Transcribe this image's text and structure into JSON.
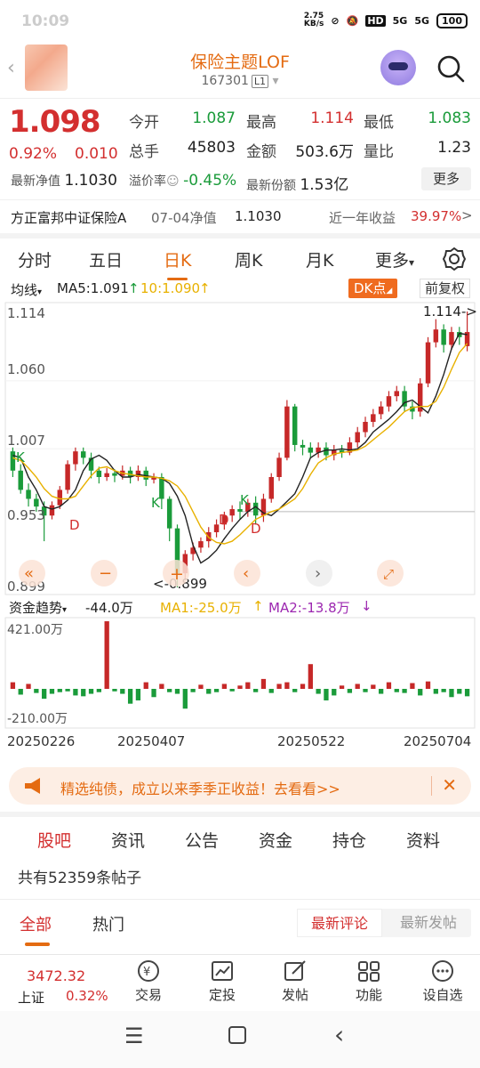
{
  "status": {
    "time": "10:09",
    "net_speed": "2.75\nKB/s",
    "battery": "100",
    "sig1": "5G",
    "sig2": "5G",
    "hd": "HD"
  },
  "header": {
    "back": "‹",
    "title": "保险主题LOF",
    "code": "167301",
    "tag": "L1"
  },
  "quote": {
    "price": "1.098",
    "change_pct": "0.92%",
    "change_abs": "0.010",
    "open_label": "今开",
    "open": "1.087",
    "high_label": "最高",
    "high": "1.114",
    "low_label": "最低",
    "low": "1.083",
    "vol_label": "总手",
    "vol": "45803",
    "amt_label": "金额",
    "amt": "503.6万",
    "ratio_label": "量比",
    "ratio": "1.23",
    "nav_label": "最新净值",
    "nav": "1.1030",
    "premium_label": "溢价率",
    "premium": "-0.45%",
    "shares_label": "最新份额",
    "shares": "1.53亿",
    "more": "更多"
  },
  "fund": {
    "name": "方正富邦中证保险A",
    "date": "07-04净值",
    "nav": "1.1030",
    "ret_label": "近一年收益",
    "ret": "39.97%",
    "arrow": ">"
  },
  "tabs": [
    "分时",
    "五日",
    "日K",
    "周K",
    "月K",
    "更多"
  ],
  "ma_row": {
    "ma_label": "均线",
    "ma5": "MA5:1.091",
    "ma10": "10:1.090",
    "dk": "DK点",
    "fq": "前复权"
  },
  "chart_labels": {
    "y1": "1.114",
    "y2": "1.060",
    "y3": "1.007",
    "y4": "0.953",
    "y5": "0.899",
    "low_mark": "<-0.899",
    "high_mark": "1.114->"
  },
  "flow": {
    "label": "资金趋势",
    "value": "-44.0万",
    "ma1": "MA1:-25.0万",
    "ma2": "MA2:-13.8万",
    "top": "421.00万",
    "bottom": "-210.00万",
    "dates": [
      "20250226",
      "20250407",
      "20250522",
      "20250704"
    ]
  },
  "banner": {
    "text": "精选纯债，成立以来季季正收益！去看看>>"
  },
  "sections": [
    "股吧",
    "资讯",
    "公告",
    "资金",
    "持仓",
    "资料"
  ],
  "post_count": "共有52359条帖子",
  "subtabs": [
    "全部",
    "热门"
  ],
  "sort": [
    "最新评论",
    "最新发帖"
  ],
  "botnav": {
    "index_value": "3472.32",
    "index_name": "上证",
    "index_pct": "0.32%",
    "items": [
      "交易",
      "定投",
      "发帖",
      "功能",
      "设自选"
    ]
  },
  "chart_data": {
    "type": "candlestick",
    "ylim": [
      0.899,
      1.114
    ],
    "y_ticks": [
      1.114,
      1.06,
      1.007,
      0.953,
      0.899
    ],
    "x_ticks": [
      "20250226",
      "20250407",
      "20250522",
      "20250704"
    ],
    "series": [
      {
        "name": "MA5",
        "values": [
          1.002,
          1.0,
          0.985,
          0.975,
          0.962,
          0.96,
          0.962,
          0.967,
          0.975,
          0.99,
          0.999,
          1.002,
          0.998,
          0.99,
          0.985,
          0.985,
          0.987,
          0.986,
          0.985,
          0.984,
          0.98,
          0.97,
          0.955,
          0.932,
          0.918,
          0.922,
          0.928,
          0.937,
          0.945,
          0.952,
          0.958,
          0.962,
          0.957,
          0.955,
          0.96,
          0.966,
          0.972,
          0.985,
          1.0,
          1.004,
          1.006,
          1.006,
          1.007,
          1.006,
          1.007,
          1.012,
          1.02,
          1.025,
          1.03,
          1.036,
          1.043,
          1.045,
          1.04,
          1.035,
          1.048,
          1.065,
          1.085,
          1.097,
          1.096
        ]
      },
      {
        "name": "MA10",
        "values": [
          1.0,
          0.998,
          0.992,
          0.985,
          0.976,
          0.97,
          0.968,
          0.968,
          0.97,
          0.978,
          0.986,
          0.992,
          0.993,
          0.99,
          0.988,
          0.987,
          0.986,
          0.985,
          0.985,
          0.984,
          0.982,
          0.978,
          0.97,
          0.958,
          0.946,
          0.938,
          0.934,
          0.933,
          0.935,
          0.94,
          0.946,
          0.952,
          0.955,
          0.958,
          0.96,
          0.964,
          0.968,
          0.976,
          0.987,
          0.996,
          1.0,
          1.003,
          1.004,
          1.005,
          1.006,
          1.009,
          1.014,
          1.019,
          1.024,
          1.03,
          1.036,
          1.039,
          1.04,
          1.04,
          1.044,
          1.055,
          1.069,
          1.082,
          1.089
        ]
      }
    ],
    "candles": [
      [
        1.005,
        0.99,
        1.008,
        0.985
      ],
      [
        0.99,
        0.975,
        0.995,
        0.972
      ],
      [
        0.975,
        0.968,
        0.98,
        0.962
      ],
      [
        0.968,
        0.962,
        0.972,
        0.958
      ],
      [
        0.962,
        0.955,
        0.966,
        0.935
      ],
      [
        0.955,
        0.963,
        0.966,
        0.952
      ],
      [
        0.963,
        0.975,
        0.978,
        0.96
      ],
      [
        0.975,
        0.995,
        0.998,
        0.972
      ],
      [
        0.995,
        1.005,
        1.008,
        0.99
      ],
      [
        1.005,
        1.0,
        1.008,
        0.995
      ],
      [
        1.0,
        0.99,
        1.004,
        0.984
      ],
      [
        0.99,
        0.985,
        0.993,
        0.98
      ],
      [
        0.985,
        0.988,
        0.992,
        0.982
      ],
      [
        0.988,
        0.986,
        0.991,
        0.981
      ],
      [
        0.986,
        0.99,
        0.994,
        0.983
      ],
      [
        0.99,
        0.985,
        0.993,
        0.98
      ],
      [
        0.985,
        0.99,
        0.994,
        0.982
      ],
      [
        0.99,
        0.983,
        0.993,
        0.978
      ],
      [
        0.983,
        0.985,
        0.988,
        0.98
      ],
      [
        0.985,
        0.968,
        0.988,
        0.96
      ],
      [
        0.968,
        0.945,
        0.97,
        0.935
      ],
      [
        0.945,
        0.91,
        0.948,
        0.899
      ],
      [
        0.91,
        0.925,
        0.928,
        0.905
      ],
      [
        0.925,
        0.93,
        0.934,
        0.92
      ],
      [
        0.93,
        0.935,
        0.938,
        0.926
      ],
      [
        0.935,
        0.942,
        0.946,
        0.93
      ],
      [
        0.942,
        0.948,
        0.952,
        0.938
      ],
      [
        0.948,
        0.955,
        0.958,
        0.944
      ],
      [
        0.955,
        0.96,
        0.963,
        0.95
      ],
      [
        0.96,
        0.958,
        0.966,
        0.952
      ],
      [
        0.958,
        0.965,
        0.968,
        0.954
      ],
      [
        0.965,
        0.955,
        0.97,
        0.948
      ],
      [
        0.955,
        0.968,
        0.972,
        0.95
      ],
      [
        0.968,
        0.985,
        0.988,
        0.965
      ],
      [
        0.985,
        1.0,
        1.004,
        0.982
      ],
      [
        1.0,
        1.04,
        1.045,
        0.998
      ],
      [
        1.04,
        1.01,
        1.042,
        1.005
      ],
      [
        1.01,
        1.008,
        1.014,
        1.002
      ],
      [
        1.008,
        1.004,
        1.012,
        1.0
      ],
      [
        1.004,
        1.008,
        1.012,
        1.0
      ],
      [
        1.008,
        1.002,
        1.012,
        0.998
      ],
      [
        1.002,
        1.006,
        1.01,
        0.998
      ],
      [
        1.006,
        1.004,
        1.01,
        1.0
      ],
      [
        1.004,
        1.012,
        1.016,
        1.002
      ],
      [
        1.012,
        1.02,
        1.024,
        1.008
      ],
      [
        1.02,
        1.028,
        1.032,
        1.016
      ],
      [
        1.028,
        1.034,
        1.038,
        1.024
      ],
      [
        1.034,
        1.04,
        1.044,
        1.03
      ],
      [
        1.04,
        1.048,
        1.052,
        1.036
      ],
      [
        1.048,
        1.052,
        1.056,
        1.044
      ],
      [
        1.052,
        1.04,
        1.056,
        1.036
      ],
      [
        1.04,
        1.036,
        1.044,
        1.03
      ],
      [
        1.036,
        1.058,
        1.062,
        1.032
      ],
      [
        1.058,
        1.09,
        1.094,
        1.055
      ],
      [
        1.09,
        1.1,
        1.108,
        1.086
      ],
      [
        1.1,
        1.088,
        1.104,
        1.082
      ],
      [
        1.088,
        1.098,
        1.102,
        1.084
      ],
      [
        1.098,
        1.094,
        1.102,
        1.088
      ],
      [
        1.087,
        1.098,
        1.114,
        1.083
      ]
    ],
    "flows": [
      40,
      -35,
      30,
      -25,
      -60,
      -30,
      -20,
      -15,
      -40,
      -45,
      -30,
      -20,
      410,
      -15,
      -30,
      -90,
      -70,
      40,
      -50,
      30,
      -20,
      -30,
      -120,
      -20,
      25,
      -30,
      -20,
      30,
      -15,
      20,
      40,
      -20,
      60,
      -25,
      30,
      40,
      -20,
      30,
      150,
      -30,
      -70,
      -40,
      20,
      -25,
      30,
      -20,
      25,
      -30,
      40,
      -20,
      -25,
      35,
      -40,
      45,
      -30,
      -20,
      -50,
      -30,
      -45
    ]
  }
}
